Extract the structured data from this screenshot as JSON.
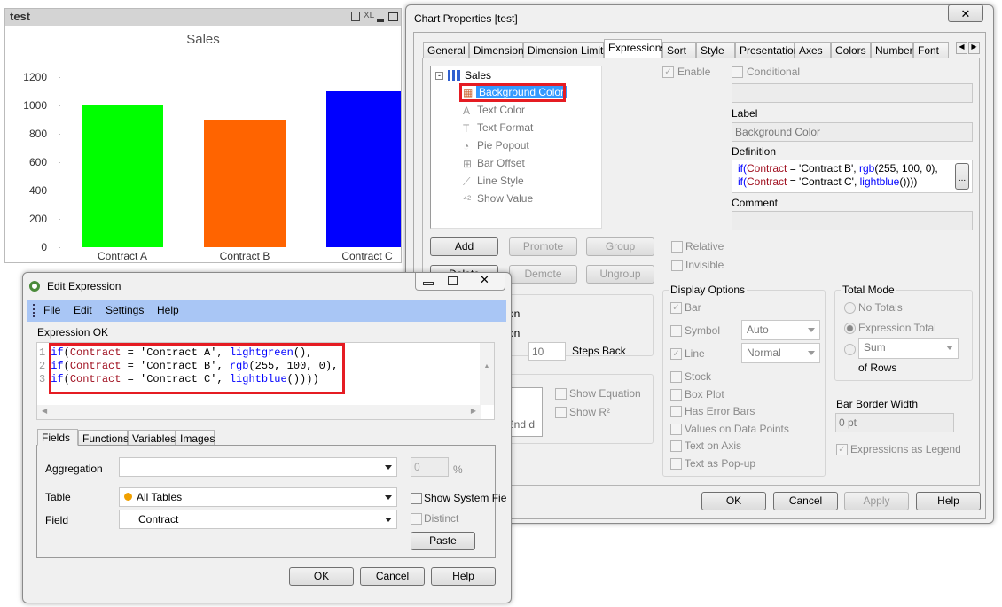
{
  "chart_window": {
    "title": "test",
    "icons": [
      "print-icon",
      "xl-icon",
      "minimize-icon",
      "maximize-icon"
    ],
    "xl_label": "XL"
  },
  "chart_data": {
    "type": "bar",
    "title": "Sales",
    "categories": [
      "Contract A",
      "Contract B",
      "Contract C"
    ],
    "values": [
      1000,
      900,
      1100
    ],
    "colors": [
      "#00ff00",
      "#ff6400",
      "#0000ff"
    ],
    "ylim": [
      0,
      1200
    ],
    "yticks": [
      "0",
      "200",
      "400",
      "600",
      "800",
      "1000",
      "1200"
    ],
    "xlabel": "",
    "ylabel": "",
    "grid": false
  },
  "props": {
    "title": "Chart Properties [test]",
    "tabs": [
      "General",
      "Dimensions",
      "Dimension Limits",
      "Expressions",
      "Sort",
      "Style",
      "Presentation",
      "Axes",
      "Colors",
      "Number",
      "Font"
    ],
    "tree": {
      "root": "Sales",
      "items": [
        "Background Color",
        "Text Color",
        "Text Format",
        "Pie Popout",
        "Bar Offset",
        "Line Style",
        "Show Value"
      ],
      "selected": "Background Color"
    },
    "buttons": {
      "add": "Add",
      "promote": "Promote",
      "group": "Group",
      "delete": "Delete",
      "demote": "Demote",
      "ungroup": "Ungroup"
    },
    "enable": "Enable",
    "conditional": "Conditional",
    "label_caption": "Label",
    "label_value": "Background Color",
    "definition_caption": "Definition",
    "definition_lines": [
      [
        "if(",
        "Contract",
        " = 'Contract B', ",
        "rgb",
        "(255, 100, 0),"
      ],
      [
        "if(",
        "Contract",
        " = 'Contract C', ",
        "lightblue",
        "()))) "
      ]
    ],
    "ellipsis": "...",
    "comment_caption": "Comment",
    "relative": "Relative",
    "invisible": "Invisible",
    "partial": {
      "on1": "on",
      "on2": "on",
      "steps_value": "10",
      "steps_back": "Steps Back",
      "list_text": "2nd d",
      "show_equation": "Show Equation",
      "show_r2": "Show R²"
    },
    "display_options": {
      "title": "Display Options",
      "bar": "Bar",
      "symbol": "Symbol",
      "symbol_value": "Auto",
      "line": "Line",
      "line_value": "Normal",
      "stock": "Stock",
      "box_plot": "Box Plot",
      "error_bars": "Has Error Bars",
      "values_on_points": "Values on Data Points",
      "text_on_axis": "Text on Axis",
      "text_popup": "Text as Pop-up"
    },
    "total_mode": {
      "title": "Total Mode",
      "no_totals": "No Totals",
      "expression_total": "Expression Total",
      "sum": "Sum",
      "of_rows": "of Rows"
    },
    "bar_border_width": "Bar Border Width",
    "bar_border_value": "0 pt",
    "expressions_as_legend": "Expressions as Legend",
    "footer": {
      "ok": "OK",
      "cancel": "Cancel",
      "apply": "Apply",
      "help": "Help"
    }
  },
  "edit": {
    "title": "Edit Expression",
    "menu": [
      "File",
      "Edit",
      "Settings",
      "Help"
    ],
    "status": "Expression OK",
    "lines": [
      [
        "1",
        "if",
        "(",
        "Contract",
        " = 'Contract A', ",
        "lightgreen",
        "(),"
      ],
      [
        "2",
        "if",
        "(",
        "Contract",
        " = 'Contract B', ",
        "rgb",
        "(255, 100, 0),"
      ],
      [
        "3",
        "if",
        "(",
        "Contract",
        " = 'Contract C', ",
        "lightblue",
        "()))) "
      ]
    ],
    "tabs": [
      "Fields",
      "Functions",
      "Variables",
      "Images"
    ],
    "aggregation": "Aggregation",
    "aggregation_value": "",
    "percent_value": "0",
    "percent": "%",
    "table": "Table",
    "table_value": "All Tables",
    "field": "Field",
    "field_value": "Contract",
    "show_system": "Show System Fie",
    "distinct": "Distinct",
    "paste": "Paste",
    "footer": {
      "ok": "OK",
      "cancel": "Cancel",
      "help": "Help"
    }
  }
}
